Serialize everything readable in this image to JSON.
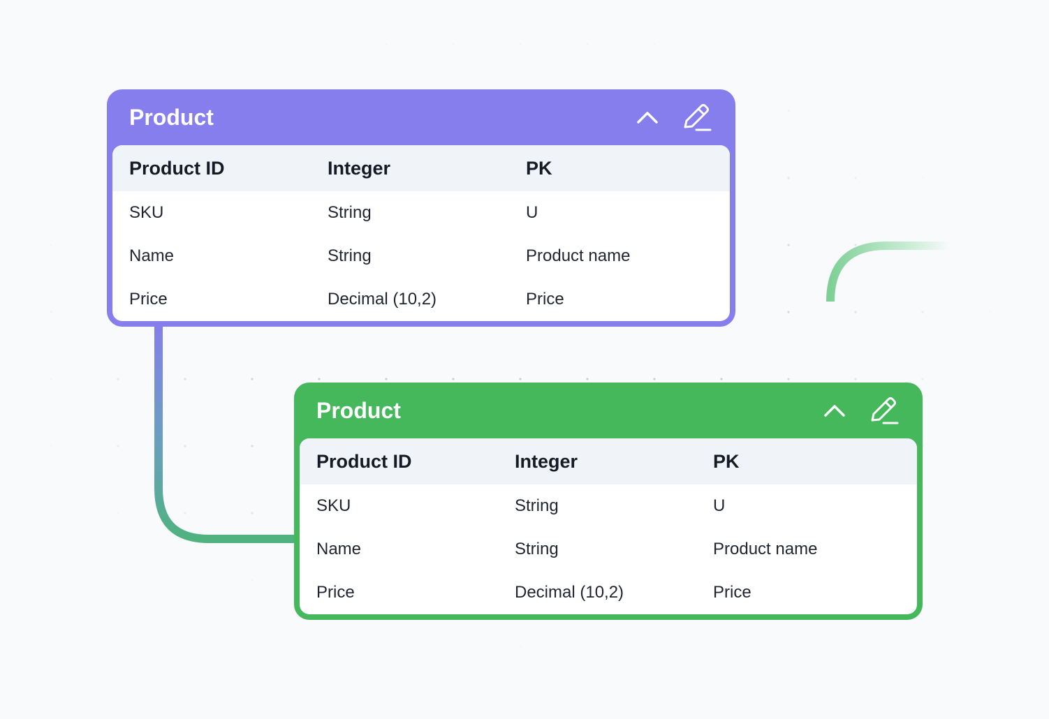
{
  "colors": {
    "purple": "#857eec",
    "green": "#45b85c",
    "background": "#f8fafc"
  },
  "tables": [
    {
      "title": "Product",
      "header_color": "#857eec",
      "icons": [
        "chevron-up-icon",
        "pencil-icon"
      ],
      "columns": [
        "Product ID",
        "Integer",
        "PK"
      ],
      "rows": [
        [
          "SKU",
          "String",
          "U"
        ],
        [
          "Name",
          "String",
          "Product name"
        ],
        [
          "Price",
          "Decimal (10,2)",
          "Price"
        ]
      ]
    },
    {
      "title": "Product",
      "header_color": "#45b85c",
      "icons": [
        "chevron-up-icon",
        "pencil-icon"
      ],
      "columns": [
        "Product ID",
        "Integer",
        "PK"
      ],
      "rows": [
        [
          "SKU",
          "String",
          "U"
        ],
        [
          "Name",
          "String",
          "Product name"
        ],
        [
          "Price",
          "Decimal (10,2)",
          "Price"
        ]
      ]
    }
  ]
}
